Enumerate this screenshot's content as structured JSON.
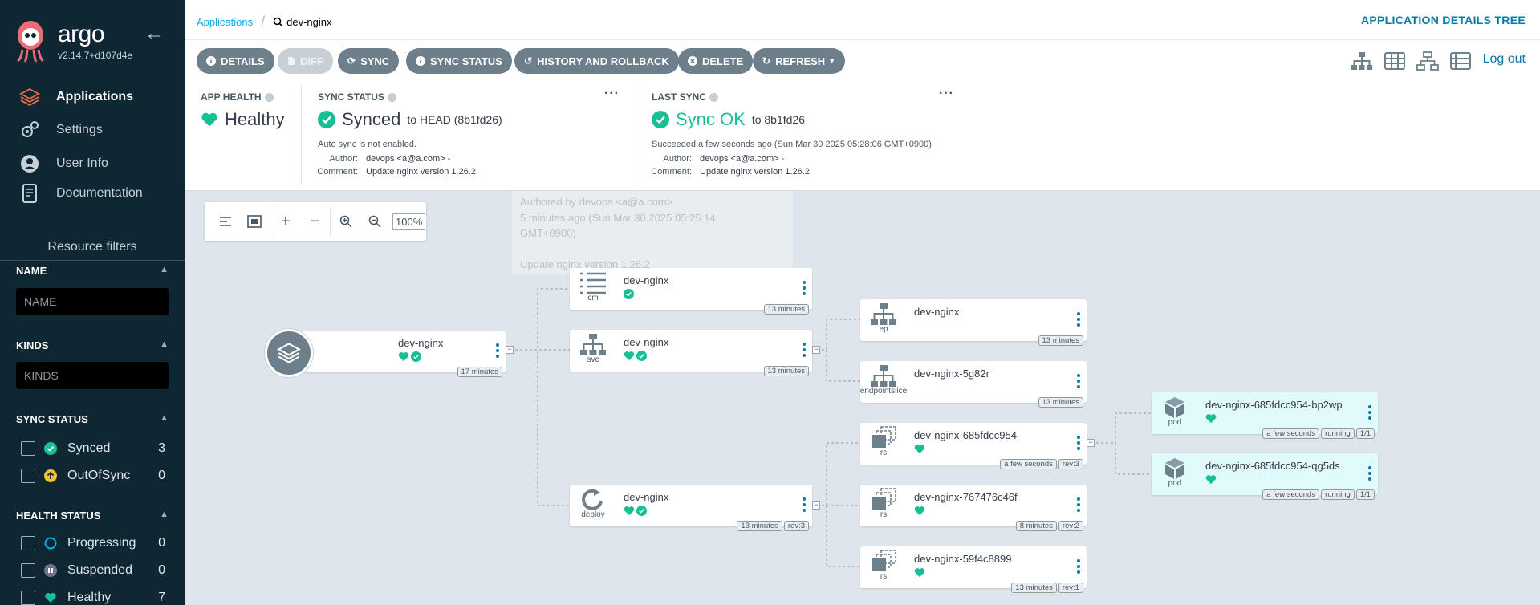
{
  "sidebar": {
    "brand": "argo",
    "version": "v2.14.7+d107d4e",
    "nav": [
      {
        "label": "Applications",
        "icon": "stack-icon"
      },
      {
        "label": "Settings",
        "icon": "gears-icon"
      },
      {
        "label": "User Info",
        "icon": "user-icon"
      },
      {
        "label": "Documentation",
        "icon": "book-icon"
      }
    ],
    "filters": {
      "title": "Resource filters",
      "name_head": "NAME",
      "name_placeholder": "NAME",
      "kinds_head": "KINDS",
      "kinds_placeholder": "KINDS",
      "sync_head": "SYNC STATUS",
      "sync": [
        {
          "label": "Synced",
          "count": "3"
        },
        {
          "label": "OutOfSync",
          "count": "0"
        }
      ],
      "health_head": "HEALTH STATUS",
      "health": [
        {
          "label": "Progressing",
          "count": "0"
        },
        {
          "label": "Suspended",
          "count": "0"
        },
        {
          "label": "Healthy",
          "count": "7"
        }
      ]
    }
  },
  "topbar": {
    "breadcrumb_root": "Applications",
    "breadcrumb_current": "dev-nginx",
    "page_title": "APPLICATION DETAILS TREE"
  },
  "toolbar": {
    "details": "DETAILS",
    "diff": "DIFF",
    "sync": "SYNC",
    "sync_status": "SYNC STATUS",
    "history": "HISTORY AND ROLLBACK",
    "delete": "DELETE",
    "refresh": "REFRESH",
    "logout": "Log out"
  },
  "status": {
    "app_health_label": "APP HEALTH",
    "app_health": "Healthy",
    "sync_status_label": "SYNC STATUS",
    "sync_status": "Synced",
    "sync_to": "to HEAD (8b1fd26)",
    "auto_sync": "Auto sync is not enabled.",
    "author_label": "Author:",
    "author": "devops <a@a.com> -",
    "comment_label": "Comment:",
    "comment": "Update nginx version 1.26.2",
    "last_sync_label": "LAST SYNC",
    "last_sync": "Sync OK",
    "last_sync_to": "to 8b1fd26",
    "succeeded": "Succeeded a few seconds ago (Sun Mar 30 2025 05:28:06 GMT+0900)",
    "ls_author_label": "Author:",
    "ls_author": "devops <a@a.com> -",
    "ls_comment_label": "Comment:",
    "ls_comment": "Update nginx version 1.26.2"
  },
  "tooltip": {
    "line1": "Authored by devops <a@a.com>",
    "line2": "5 minutes ago (Sun Mar 30 2025 05:25:14",
    "line3": "GMT+0900)",
    "line4": "Update nginx version 1.26.2"
  },
  "zoom": {
    "percent": "100%"
  },
  "graph": {
    "app": {
      "name": "dev-nginx",
      "age": "17 minutes"
    },
    "nodes": [
      {
        "id": "cm",
        "name": "dev-nginx",
        "kind": "cm",
        "tags": [
          "13 minutes"
        ]
      },
      {
        "id": "svc",
        "name": "dev-nginx",
        "kind": "svc",
        "tags": [
          "13 minutes"
        ]
      },
      {
        "id": "deploy",
        "name": "dev-nginx",
        "kind": "deploy",
        "tags": [
          "13 minutes",
          "rev:3"
        ]
      },
      {
        "id": "ep",
        "name": "dev-nginx",
        "kind": "ep",
        "tags": [
          "13 minutes"
        ]
      },
      {
        "id": "eps",
        "name": "dev-nginx-5g82r",
        "kind": "endpointslice",
        "tags": [
          "13 minutes"
        ]
      },
      {
        "id": "rs1",
        "name": "dev-nginx-685fdcc954",
        "kind": "rs",
        "tags": [
          "a few seconds",
          "rev:3"
        ]
      },
      {
        "id": "rs2",
        "name": "dev-nginx-767476c46f",
        "kind": "rs",
        "tags": [
          "8 minutes",
          "rev:2"
        ]
      },
      {
        "id": "rs3",
        "name": "dev-nginx-59f4c8899",
        "kind": "rs",
        "tags": [
          "13 minutes",
          "rev:1"
        ]
      },
      {
        "id": "pod1",
        "name": "dev-nginx-685fdcc954-bp2wp",
        "kind": "pod",
        "tags": [
          "a few seconds",
          "running",
          "1/1"
        ]
      },
      {
        "id": "pod2",
        "name": "dev-nginx-685fdcc954-qg5ds",
        "kind": "pod",
        "tags": [
          "a few seconds",
          "running",
          "1/1"
        ]
      }
    ]
  },
  "colors": {
    "sidebar_bg": "#0f2733",
    "accent": "#0a7aa5",
    "healthy": "#18be94",
    "button": "#6d7f8b",
    "pod_bg": "#e1fafa"
  }
}
